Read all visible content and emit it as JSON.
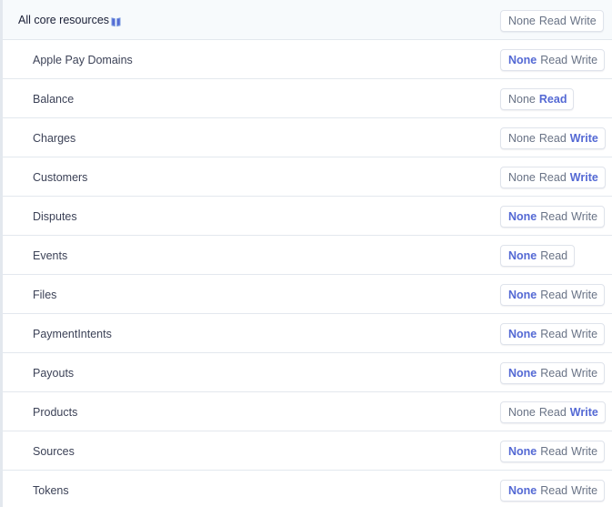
{
  "colors": {
    "accent": "#5469d4",
    "muted_text": "#697386",
    "label_text": "#3c4257",
    "header_bg": "#f7fafc",
    "divider": "#e3e8ee"
  },
  "header": {
    "label": "All core resources",
    "icon": "book-icon",
    "options": [
      "None",
      "Read",
      "Write"
    ],
    "selected": null
  },
  "resources": [
    {
      "name": "Apple Pay Domains",
      "options": [
        "None",
        "Read",
        "Write"
      ],
      "selected": "None"
    },
    {
      "name": "Balance",
      "options": [
        "None",
        "Read"
      ],
      "selected": "Read"
    },
    {
      "name": "Charges",
      "options": [
        "None",
        "Read",
        "Write"
      ],
      "selected": "Write"
    },
    {
      "name": "Customers",
      "options": [
        "None",
        "Read",
        "Write"
      ],
      "selected": "Write"
    },
    {
      "name": "Disputes",
      "options": [
        "None",
        "Read",
        "Write"
      ],
      "selected": "None"
    },
    {
      "name": "Events",
      "options": [
        "None",
        "Read"
      ],
      "selected": "None"
    },
    {
      "name": "Files",
      "options": [
        "None",
        "Read",
        "Write"
      ],
      "selected": "None"
    },
    {
      "name": "PaymentIntents",
      "options": [
        "None",
        "Read",
        "Write"
      ],
      "selected": "None"
    },
    {
      "name": "Payouts",
      "options": [
        "None",
        "Read",
        "Write"
      ],
      "selected": "None"
    },
    {
      "name": "Products",
      "options": [
        "None",
        "Read",
        "Write"
      ],
      "selected": "Write"
    },
    {
      "name": "Sources",
      "options": [
        "None",
        "Read",
        "Write"
      ],
      "selected": "None"
    },
    {
      "name": "Tokens",
      "options": [
        "None",
        "Read",
        "Write"
      ],
      "selected": "None"
    }
  ]
}
